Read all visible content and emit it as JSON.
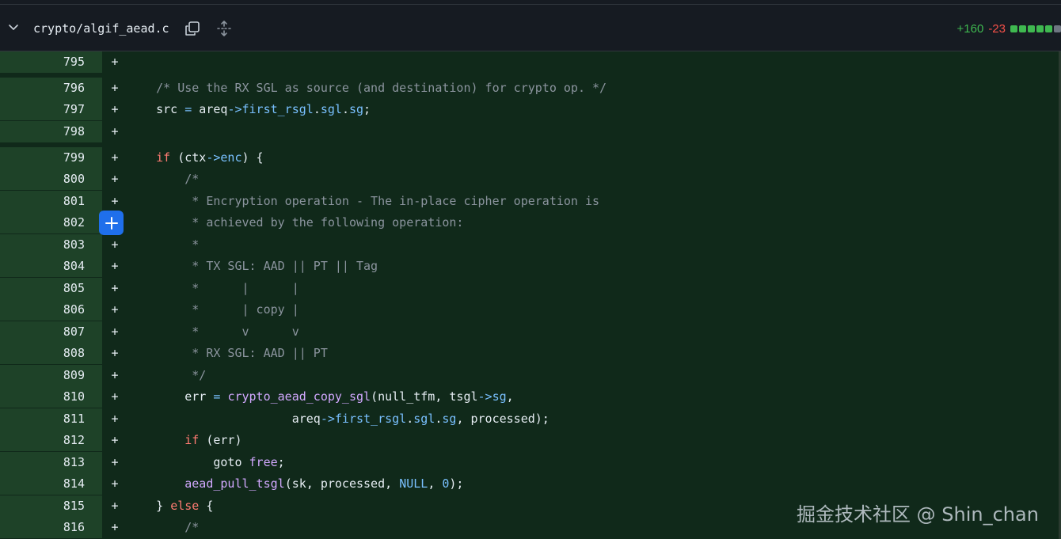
{
  "file": {
    "name": "crypto/algif_aead.c",
    "additions": "+160",
    "deletions": "-23",
    "stat_bars": [
      "#3fb950",
      "#3fb950",
      "#3fb950",
      "#3fb950",
      "#3fb950",
      "#6e7681"
    ]
  },
  "icons": {
    "collapse": "chevron-down-icon",
    "copy": "copy-icon",
    "expand": "unfold-icon",
    "add_comment": "plus-icon"
  },
  "colors": {
    "added_line_bg": "#10291a",
    "gutter_bg": "#1e4228",
    "comment_button": "#1f6feb"
  },
  "diff_lines": [
    {
      "num": "795",
      "marker": "+",
      "tokens": []
    },
    {
      "num": "796",
      "marker": "+",
      "tokens": [
        [
          "    ",
          "plain"
        ],
        [
          "/* Use the RX SGL as source (and destination) for crypto op. */",
          "comment"
        ]
      ]
    },
    {
      "num": "797",
      "marker": "+",
      "tokens": [
        [
          "    src ",
          "plain"
        ],
        [
          "=",
          "op"
        ],
        [
          " areq",
          "plain"
        ],
        [
          "->",
          "op"
        ],
        [
          "first_rsgl",
          "field"
        ],
        [
          ".",
          "plain"
        ],
        [
          "sgl",
          "field"
        ],
        [
          ".",
          "plain"
        ],
        [
          "sg",
          "field"
        ],
        [
          ";",
          "plain"
        ]
      ]
    },
    {
      "num": "798",
      "marker": "+",
      "tokens": []
    },
    {
      "num": "799",
      "marker": "+",
      "tokens": [
        [
          "    ",
          "plain"
        ],
        [
          "if",
          "kw"
        ],
        [
          " (ctx",
          "plain"
        ],
        [
          "->",
          "op"
        ],
        [
          "enc",
          "field"
        ],
        [
          ") {",
          "plain"
        ]
      ]
    },
    {
      "num": "800",
      "marker": "+",
      "tokens": [
        [
          "        ",
          "plain"
        ],
        [
          "/*",
          "comment"
        ]
      ]
    },
    {
      "num": "801",
      "marker": "+",
      "tokens": [
        [
          "         ",
          "plain"
        ],
        [
          "* Encryption operation - The in-place cipher operation is",
          "comment"
        ]
      ]
    },
    {
      "num": "802",
      "marker": "+",
      "tokens": [
        [
          "         ",
          "plain"
        ],
        [
          "* achieved by the following operation:",
          "comment"
        ]
      ]
    },
    {
      "num": "803",
      "marker": "+",
      "tokens": [
        [
          "         ",
          "plain"
        ],
        [
          "*",
          "comment"
        ]
      ]
    },
    {
      "num": "804",
      "marker": "+",
      "tokens": [
        [
          "         ",
          "plain"
        ],
        [
          "* TX SGL: AAD || PT || Tag",
          "comment"
        ]
      ]
    },
    {
      "num": "805",
      "marker": "+",
      "tokens": [
        [
          "         ",
          "plain"
        ],
        [
          "*      |      |",
          "comment"
        ]
      ]
    },
    {
      "num": "806",
      "marker": "+",
      "tokens": [
        [
          "         ",
          "plain"
        ],
        [
          "*      | copy |",
          "comment"
        ]
      ]
    },
    {
      "num": "807",
      "marker": "+",
      "tokens": [
        [
          "         ",
          "plain"
        ],
        [
          "*      v      v",
          "comment"
        ]
      ]
    },
    {
      "num": "808",
      "marker": "+",
      "tokens": [
        [
          "         ",
          "plain"
        ],
        [
          "* RX SGL: AAD || PT",
          "comment"
        ]
      ]
    },
    {
      "num": "809",
      "marker": "+",
      "tokens": [
        [
          "         ",
          "plain"
        ],
        [
          "*/",
          "comment"
        ]
      ]
    },
    {
      "num": "810",
      "marker": "+",
      "tokens": [
        [
          "        err ",
          "plain"
        ],
        [
          "=",
          "op"
        ],
        [
          " ",
          "plain"
        ],
        [
          "crypto_aead_copy_sgl",
          "fn"
        ],
        [
          "(null_tfm, tsgl",
          "plain"
        ],
        [
          "->",
          "op"
        ],
        [
          "sg",
          "field"
        ],
        [
          ",",
          "plain"
        ]
      ]
    },
    {
      "num": "811",
      "marker": "+",
      "tokens": [
        [
          "                       areq",
          "plain"
        ],
        [
          "->",
          "op"
        ],
        [
          "first_rsgl",
          "field"
        ],
        [
          ".",
          "plain"
        ],
        [
          "sgl",
          "field"
        ],
        [
          ".",
          "plain"
        ],
        [
          "sg",
          "field"
        ],
        [
          ", processed);",
          "plain"
        ]
      ]
    },
    {
      "num": "812",
      "marker": "+",
      "tokens": [
        [
          "        ",
          "plain"
        ],
        [
          "if",
          "kw"
        ],
        [
          " (err)",
          "plain"
        ]
      ]
    },
    {
      "num": "813",
      "marker": "+",
      "tokens": [
        [
          "            goto ",
          "plain"
        ],
        [
          "free",
          "fn"
        ],
        [
          ";",
          "plain"
        ]
      ]
    },
    {
      "num": "814",
      "marker": "+",
      "tokens": [
        [
          "        ",
          "plain"
        ],
        [
          "aead_pull_tsgl",
          "fn"
        ],
        [
          "(sk, processed, ",
          "plain"
        ],
        [
          "NULL",
          "const"
        ],
        [
          ", ",
          "plain"
        ],
        [
          "0",
          "const"
        ],
        [
          ");",
          "plain"
        ]
      ]
    },
    {
      "num": "815",
      "marker": "+",
      "tokens": [
        [
          "    } ",
          "plain"
        ],
        [
          "else",
          "kw"
        ],
        [
          " {",
          "plain"
        ]
      ]
    },
    {
      "num": "816",
      "marker": "+",
      "tokens": [
        [
          "        ",
          "plain"
        ],
        [
          "/*",
          "comment"
        ]
      ]
    }
  ],
  "watermark": "掘金技术社区 @ Shin_chan"
}
